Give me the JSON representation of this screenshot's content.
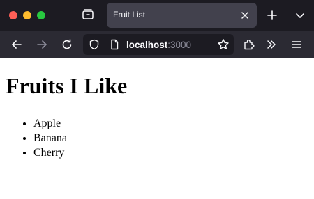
{
  "window": {
    "controls": [
      "close",
      "minimize",
      "zoom"
    ]
  },
  "tabs": [
    {
      "title": "Fruit List",
      "active": true
    }
  ],
  "toolbar": {
    "url_host": "localhost",
    "url_port": ":3000",
    "icons": [
      "back-icon",
      "forward-icon",
      "reload-icon",
      "shield-icon",
      "page-icon",
      "bookmark-star-icon",
      "extensions-icon",
      "more-tools-icon",
      "menu-icon"
    ]
  },
  "page": {
    "heading": "Fruits I Like",
    "fruits": [
      "Apple",
      "Banana",
      "Cherry"
    ]
  },
  "colors": {
    "tabbar_bg": "#1c1b22",
    "toolbar_bg": "#2b2a33",
    "active_tab_bg": "#42414d",
    "urlbar_bg": "#1c1b22",
    "close_dot": "#ff5f57",
    "minimize_dot": "#febc2e",
    "zoom_dot": "#28c840"
  }
}
